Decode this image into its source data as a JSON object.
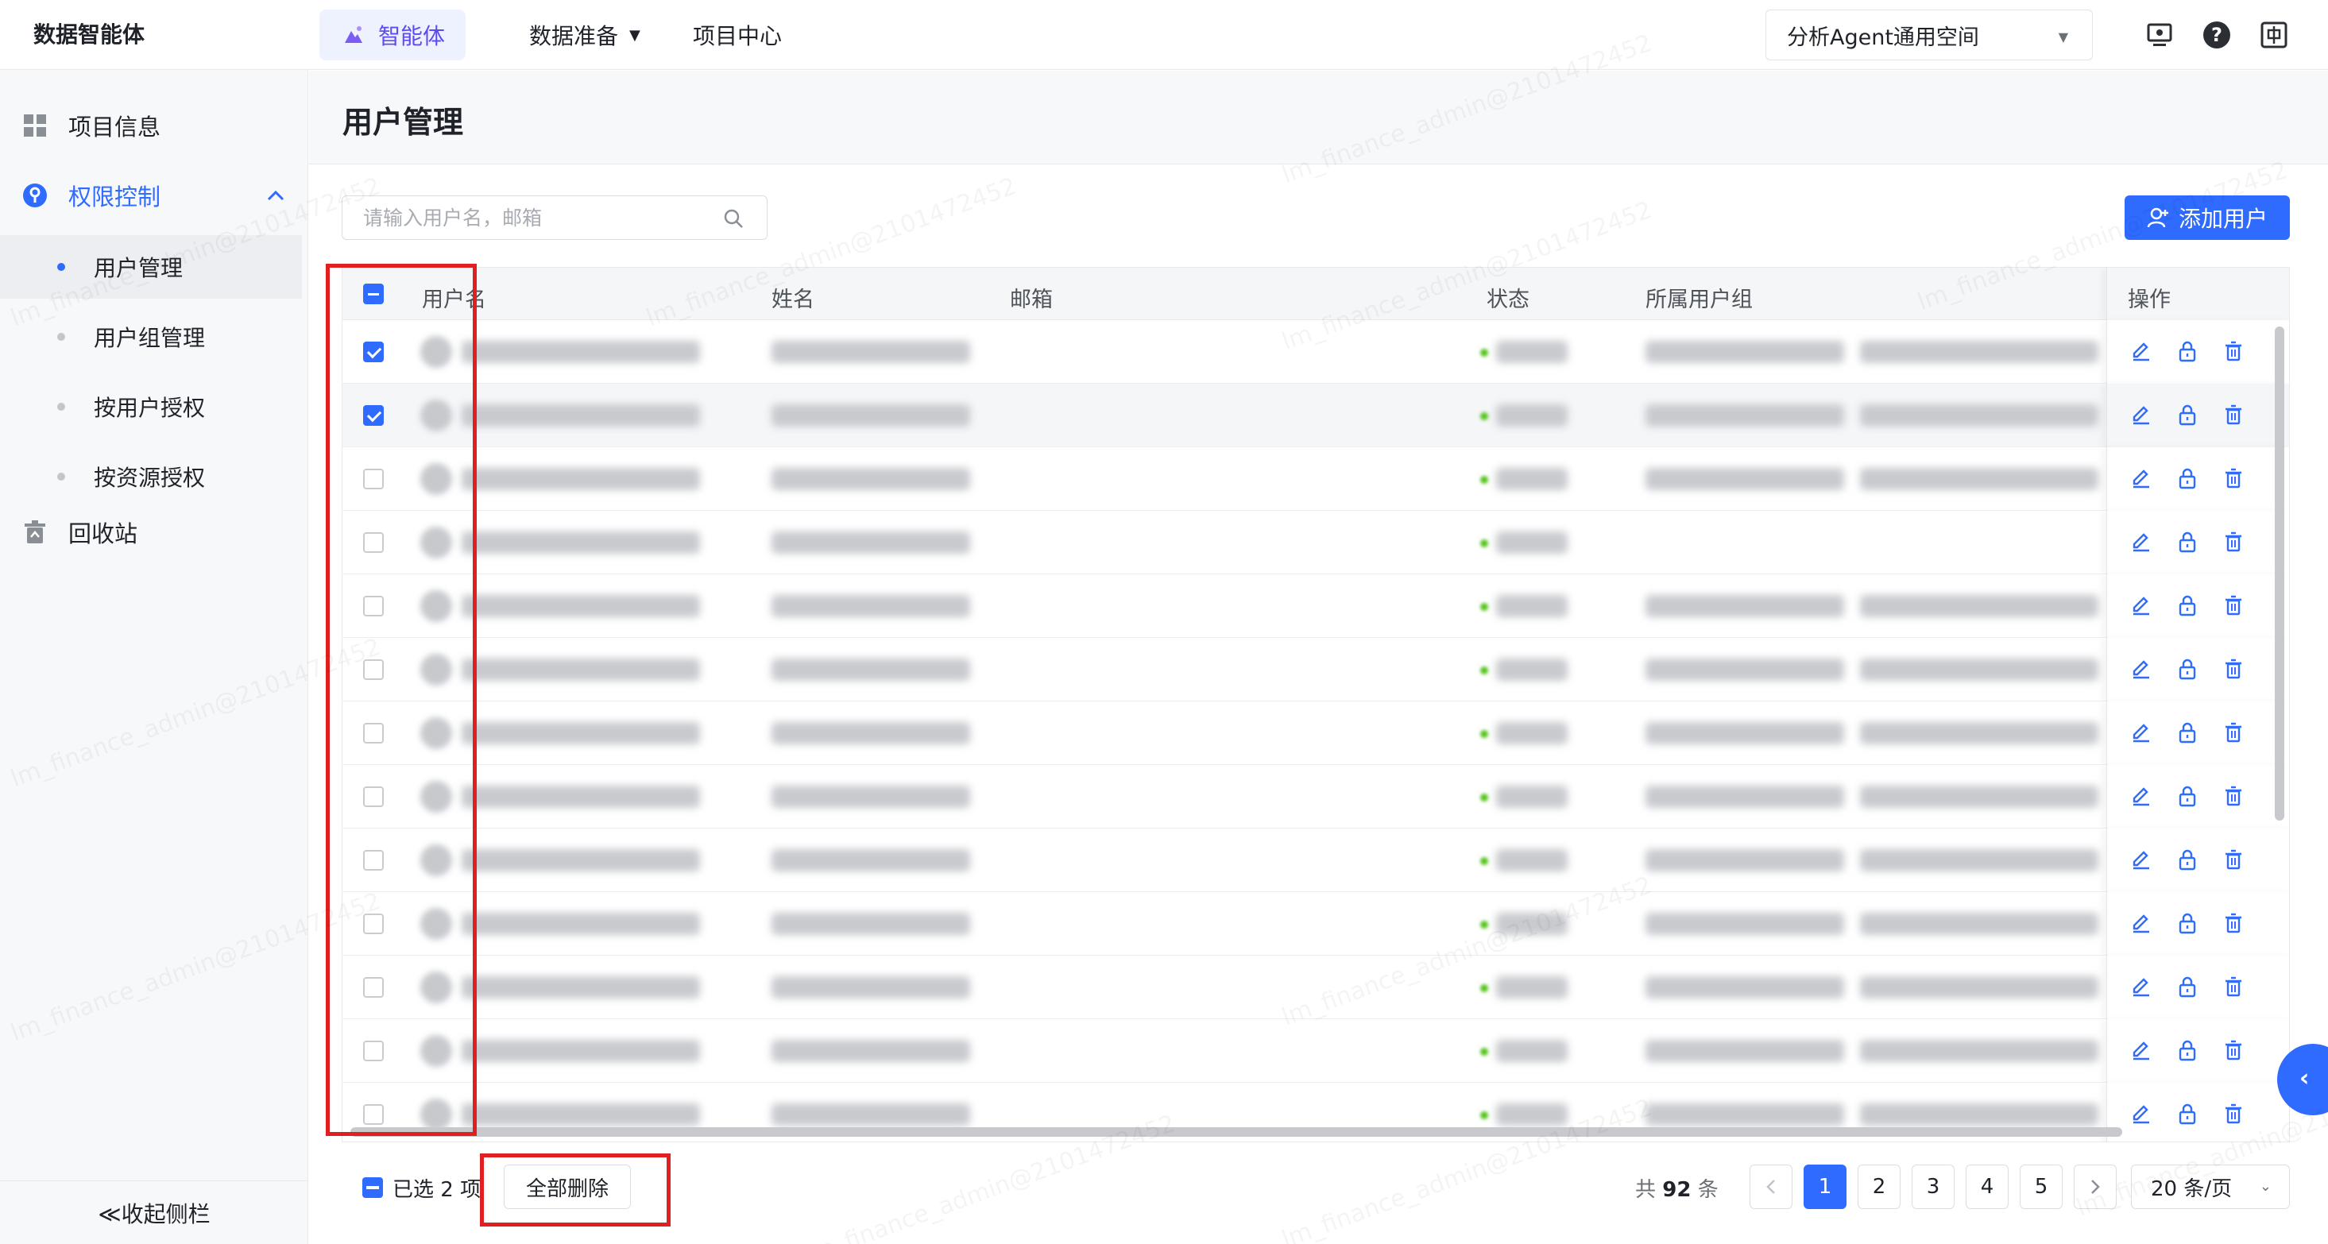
{
  "app": {
    "brand": "数据智能体"
  },
  "topnav": {
    "agent": "智能体",
    "data_prep": "数据准备",
    "project_center": "项目中心",
    "workspace": "分析Agent通用空间"
  },
  "sidebar": {
    "project_info": "项目信息",
    "permission": "权限控制",
    "sub_items": [
      "用户管理",
      "用户组管理",
      "按用户授权",
      "按资源授权"
    ],
    "recycle": "回收站",
    "collapse": "≪收起侧栏"
  },
  "page": {
    "title": "用户管理",
    "search_placeholder": "请输入用户名，邮箱",
    "add_user": "添加用户"
  },
  "table": {
    "columns": [
      "用户名",
      "姓名",
      "邮箱",
      "状态",
      "所属用户组",
      "操作"
    ],
    "rows": [
      {
        "checked": true,
        "highlight": false,
        "has_group": true
      },
      {
        "checked": true,
        "highlight": true,
        "has_group": true
      },
      {
        "checked": false,
        "highlight": false,
        "has_group": true
      },
      {
        "checked": false,
        "highlight": false,
        "has_group": false
      },
      {
        "checked": false,
        "highlight": false,
        "has_group": true
      },
      {
        "checked": false,
        "highlight": false,
        "has_group": true
      },
      {
        "checked": false,
        "highlight": false,
        "has_group": true
      },
      {
        "checked": false,
        "highlight": false,
        "has_group": true
      },
      {
        "checked": false,
        "highlight": false,
        "has_group": true
      },
      {
        "checked": false,
        "highlight": false,
        "has_group": true
      },
      {
        "checked": false,
        "highlight": false,
        "has_group": true
      },
      {
        "checked": false,
        "highlight": false,
        "has_group": true
      },
      {
        "checked": false,
        "highlight": false,
        "has_group": true
      }
    ]
  },
  "footer": {
    "selected": "已选 2 项",
    "delete_all": "全部删除",
    "total_prefix": "共",
    "total_count": "92",
    "total_suffix": "条",
    "pages": [
      "1",
      "2",
      "3",
      "4",
      "5"
    ],
    "current_page": "1",
    "page_size": "20 条/页"
  },
  "watermark": "lm_finance_admin@2101472452",
  "colors": {
    "accent": "#2f6bff",
    "agent_purple": "#5b4cf0",
    "highlight_red": "#e02020"
  }
}
